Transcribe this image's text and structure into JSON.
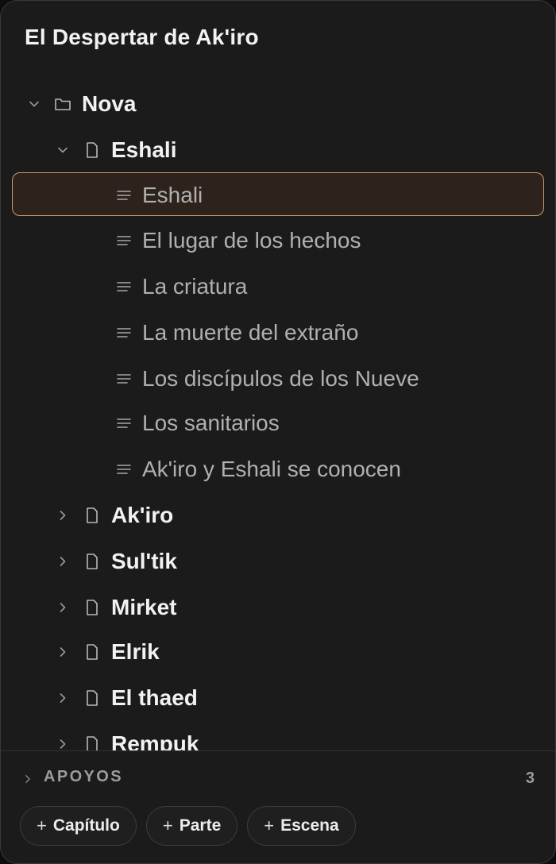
{
  "project": {
    "title": "El Despertar de Ak'iro"
  },
  "tree": {
    "folder": {
      "label": "Nova",
      "expanded": true,
      "icon": "folder-icon"
    },
    "chapters": [
      {
        "label": "Eshali",
        "expanded": true,
        "scenes": [
          {
            "label": "Eshali",
            "selected": true
          },
          {
            "label": "El lugar de los hechos"
          },
          {
            "label": "La criatura"
          },
          {
            "label": "La muerte del extraño"
          },
          {
            "label": "Los discípulos de los Nueve"
          },
          {
            "label": "Los sanitarios"
          },
          {
            "label": "Ak'iro y Eshali se conocen"
          }
        ]
      },
      {
        "label": "Ak'iro",
        "expanded": false
      },
      {
        "label": "Sul'tik",
        "expanded": false
      },
      {
        "label": "Mirket",
        "expanded": false
      },
      {
        "label": "Elrik",
        "expanded": false
      },
      {
        "label": "El thaed",
        "expanded": false
      },
      {
        "label": "Rempuk",
        "expanded": false
      }
    ]
  },
  "apoyos": {
    "label": "APOYOS",
    "count": "3"
  },
  "actions": {
    "chapter": "Capítulo",
    "part": "Parte",
    "scene": "Escena"
  },
  "colors": {
    "background": "#1b1b1b",
    "selected_bg": "#2d231c",
    "selected_border": "#c99a6e",
    "text_primary": "#f2f2f2",
    "text_secondary": "#b0b0b0"
  }
}
